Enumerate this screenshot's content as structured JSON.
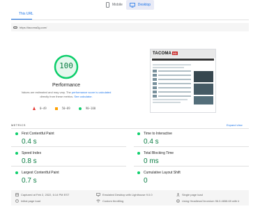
{
  "device_tabs": [
    {
      "label": "Mobile",
      "icon": "phone-icon",
      "active": false
    },
    {
      "label": "Desktop",
      "icon": "desktop-icon",
      "active": true
    }
  ],
  "url_tab_label": "This URL",
  "url": "https://tacoma3g.com/",
  "performance": {
    "score": "100",
    "title": "Performance",
    "note_prefix": "Values are estimated and may vary. The ",
    "note_link1": "performance score is calculated",
    "note_mid": " directly from these metrics. ",
    "note_link2": "See calculator.",
    "score_color": "#0cce6b"
  },
  "legend": [
    {
      "range": "0–49",
      "shape": "triangle",
      "color": "#e53935"
    },
    {
      "range": "50–89",
      "shape": "square",
      "color": "#ffa000"
    },
    {
      "range": "90–100",
      "shape": "circle",
      "color": "#0cce6b"
    }
  ],
  "thumbnail": {
    "logo": "TACOMA",
    "badge": "3G"
  },
  "metrics_label": "METRICS",
  "expand_label": "Expand view",
  "metrics": [
    {
      "name": "First Contentful Paint",
      "value": "0.4 s"
    },
    {
      "name": "Time to Interactive",
      "value": "0.4 s"
    },
    {
      "name": "Speed Index",
      "value": "0.8 s"
    },
    {
      "name": "Total Blocking Time",
      "value": "0 ms"
    },
    {
      "name": "Largest Contentful Paint",
      "value": "0.7 s"
    },
    {
      "name": "Cumulative Layout Shift",
      "value": "0"
    }
  ],
  "footer": {
    "captured": "Captured at Feb 2, 2022, 6:14 PM EST",
    "emulated": "Emulated Desktop with Lighthouse 9.0.0",
    "single_load": "Single page load",
    "initial_load": "Initial page load",
    "throttling": "Custom throttling",
    "browser": "Using HeadlessChromium 96.0.4658.69 with lr"
  }
}
